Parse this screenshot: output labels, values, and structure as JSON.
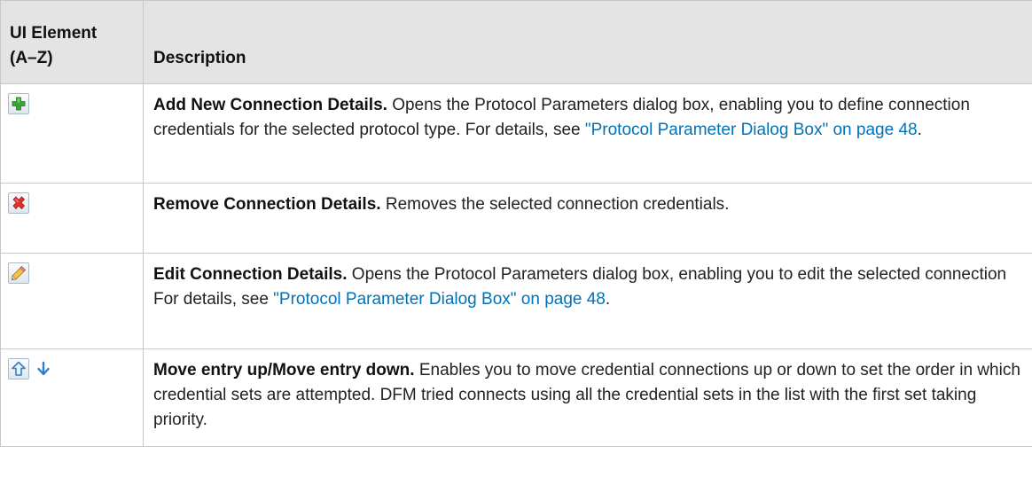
{
  "table": {
    "headers": {
      "element_line1": "UI Element",
      "element_line2": "(A–Z)",
      "description": "Description"
    },
    "rows": [
      {
        "icons": [
          "add-icon"
        ],
        "term": "Add New Connection Details.",
        "text": " Opens the Protocol Parameters dialog box, enabling you to define connection credentials for the selected protocol type. For details, see ",
        "link": "\"Protocol Parameter Dialog Box\" on page 48",
        "after": "."
      },
      {
        "icons": [
          "remove-icon"
        ],
        "term": "Remove Connection Details.",
        "text": " Removes the selected connection credentials."
      },
      {
        "icons": [
          "edit-pencil-icon"
        ],
        "term": "Edit Connection Details.",
        "text": " Opens the Protocol Parameters dialog box, enabling you to edit the selected connection For details, see ",
        "link": "\"Protocol Parameter Dialog Box\" on page 48",
        "after": "."
      },
      {
        "icons": [
          "move-up-icon",
          "move-down-icon"
        ],
        "term": "Move entry up/Move entry down.",
        "text": " Enables you to move credential connections up or down to set the order in which credential sets are attempted. DFM tried connects using all the credential sets in the list with the first set taking priority."
      }
    ]
  },
  "colors": {
    "header_bg": "#e4e4e4",
    "border": "#c8c8c8",
    "link": "#0073b8",
    "add_green": "#3aa43a",
    "remove_red": "#e0322a",
    "arrow_blue": "#2f7fd0"
  }
}
